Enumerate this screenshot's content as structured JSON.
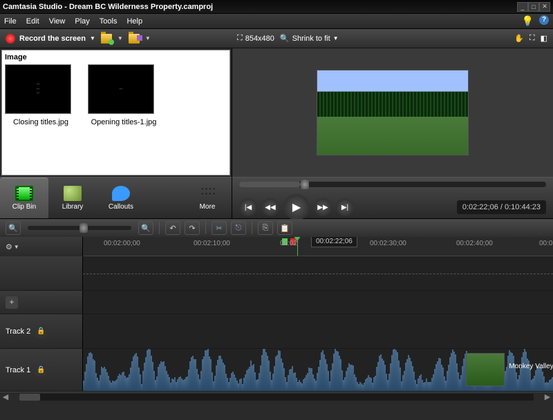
{
  "window": {
    "title": "Camtasia Studio - Dream BC Wilderness Property.camproj"
  },
  "menu": {
    "file": "File",
    "edit": "Edit",
    "view": "View",
    "play": "Play",
    "tools": "Tools",
    "help": "Help"
  },
  "toolbar": {
    "record": "Record the screen"
  },
  "bin": {
    "header": "Image",
    "items": [
      {
        "label": "Closing titles.jpg",
        "preview": "closing titles text"
      },
      {
        "label": "Opening titles-1.jpg",
        "preview": "opening titles text"
      }
    ]
  },
  "tabs": {
    "clip": "Clip Bin",
    "library": "Library",
    "callouts": "Callouts",
    "more": "More"
  },
  "preview": {
    "dimensions": "854x480",
    "zoom": "Shrink to fit"
  },
  "playback": {
    "time": "0:02:22;06 / 0:10:44:23"
  },
  "ruler": {
    "ticks": [
      "00:02:00;00",
      "00:02:10;00",
      "00:02",
      "00:02:30;00",
      "00:02:40;00",
      "00:02"
    ],
    "playhead_time": "00:02:22;06"
  },
  "tracks": {
    "track2": "Track 2",
    "track1": "Track 1",
    "clip_label": "Monkey Valley Video.m"
  }
}
